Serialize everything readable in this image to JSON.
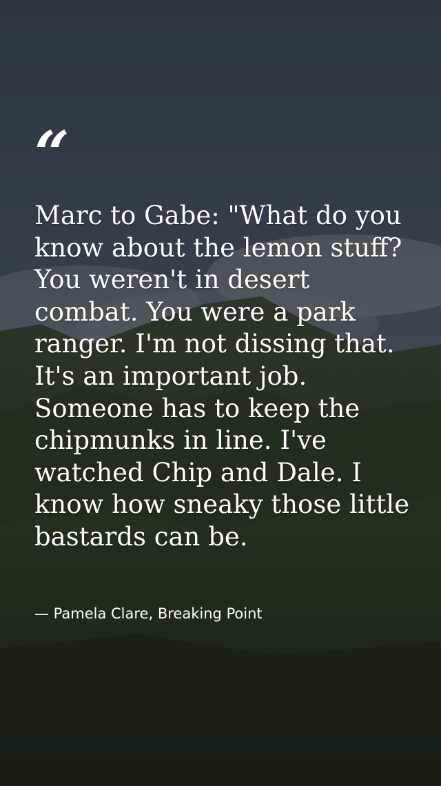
{
  "quote": {
    "mark": "“",
    "text": "Marc to Gabe: \"What do you know about the lemon stuff? You weren't in desert combat. You were a park ranger. I'm not dissing that. It's an important job. Someone has to keep the chipmunks in line. I've watched Chip and Dale. I know how sneaky those little bastards can be.",
    "attribution": "— Pamela Clare, Breaking Point"
  },
  "colors": {
    "sky": "#465568",
    "hill": "#2c3a22",
    "text": "#ffffff"
  }
}
